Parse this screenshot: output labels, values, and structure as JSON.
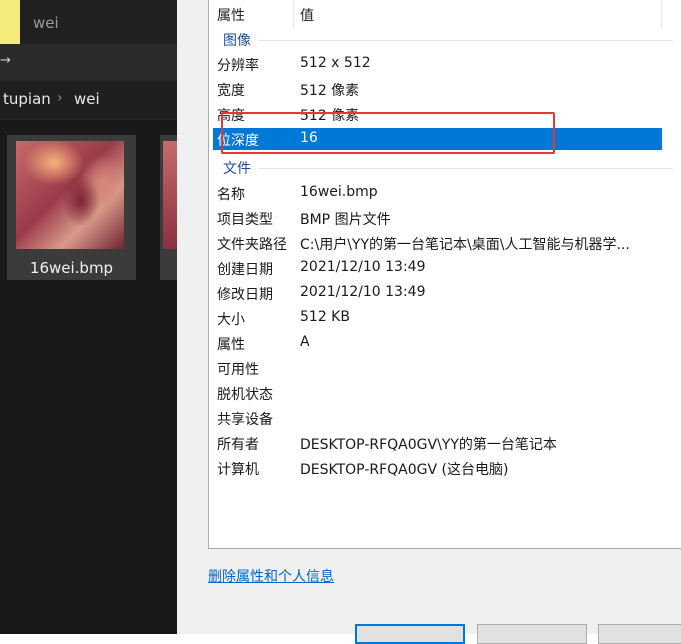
{
  "explorer": {
    "tab_title": "wei",
    "toolbar_item": "→",
    "breadcrumb": [
      "tupian",
      "wei"
    ],
    "breadcrumb_separator": "›",
    "files": [
      {
        "name": "16wei.bmp"
      }
    ]
  },
  "properties": {
    "headers": {
      "property": "属性",
      "value": "值"
    },
    "groups": {
      "image": {
        "title": "图像",
        "rows": [
          {
            "key": "分辨率",
            "value": "512 x 512"
          },
          {
            "key": "宽度",
            "value": "512 像素"
          },
          {
            "key": "高度",
            "value": "512 像素"
          },
          {
            "key": "位深度",
            "value": "16",
            "selected": true
          }
        ]
      },
      "file": {
        "title": "文件",
        "rows": [
          {
            "key": "名称",
            "value": "16wei.bmp"
          },
          {
            "key": "项目类型",
            "value": "BMP 图片文件"
          },
          {
            "key": "文件夹路径",
            "value": "C:\\用户\\YY的第一台笔记本\\桌面\\人工智能与机器学..."
          },
          {
            "key": "创建日期",
            "value": "2021/12/10 13:49"
          },
          {
            "key": "修改日期",
            "value": "2021/12/10 13:49"
          },
          {
            "key": "大小",
            "value": "512 KB"
          },
          {
            "key": "属性",
            "value": "A"
          },
          {
            "key": "可用性",
            "value": ""
          },
          {
            "key": "脱机状态",
            "value": ""
          },
          {
            "key": "共享设备",
            "value": ""
          },
          {
            "key": "所有者",
            "value": "DESKTOP-RFQA0GV\\YY的第一台笔记本"
          },
          {
            "key": "计算机",
            "value": "DESKTOP-RFQA0GV (这台电脑)"
          }
        ]
      }
    },
    "remove_link": "删除属性和个人信息"
  },
  "colors": {
    "selection": "#0078d7",
    "group_title": "#1e4a9c",
    "highlight_box": "#e03a3a",
    "link": "#0066cc"
  }
}
